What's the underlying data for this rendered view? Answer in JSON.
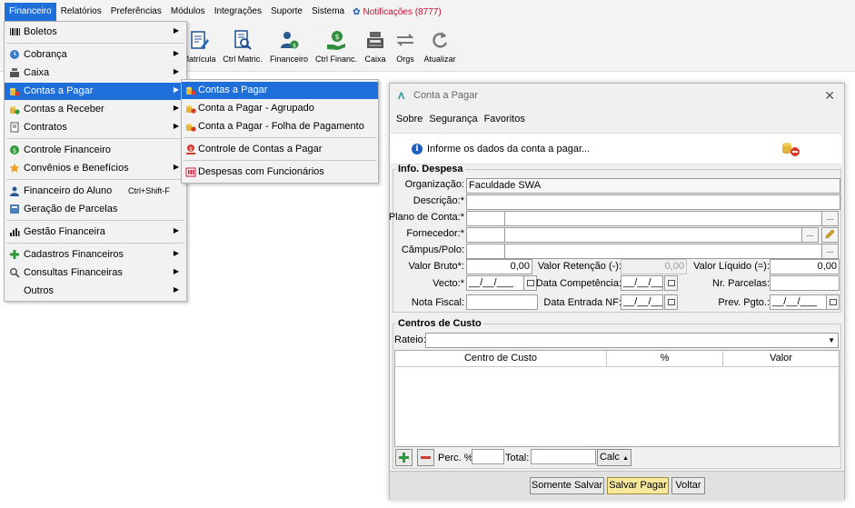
{
  "menubar": {
    "items": [
      "Financeiro",
      "Relatórios",
      "Preferências",
      "Módulos",
      "Integrações",
      "Suporte",
      "Sistema"
    ],
    "notifications": "Notificações (8777)"
  },
  "toolbar": {
    "buttons": [
      {
        "label": "Matrícula",
        "icon": "document-pen-icon"
      },
      {
        "label": "Ctrl Matric.",
        "icon": "document-search-icon"
      },
      {
        "label": "Financeiro",
        "icon": "user-money-icon"
      },
      {
        "label": "Ctrl Financ.",
        "icon": "hand-money-icon"
      },
      {
        "label": "Caixa",
        "icon": "cash-register-icon"
      },
      {
        "label": "Orgs",
        "icon": "arrows-exchange-icon"
      },
      {
        "label": "Atualizar",
        "icon": "refresh-icon"
      }
    ]
  },
  "financeiro_menu": {
    "items": [
      {
        "label": "Boletos",
        "submenu": true
      },
      {
        "label": "Cobrança",
        "submenu": true
      },
      {
        "label": "Caixa",
        "submenu": true
      },
      {
        "label": "Contas a Pagar",
        "submenu": true,
        "selected": true
      },
      {
        "label": "Contas a Receber",
        "submenu": true
      },
      {
        "label": "Contratos",
        "submenu": true
      },
      {
        "label": "Controle Financeiro",
        "submenu": false
      },
      {
        "label": "Convênios e Benefícios",
        "submenu": true
      },
      {
        "label": "Financeiro do Aluno",
        "submenu": false,
        "shortcut": "Ctrl+Shift-F"
      },
      {
        "label": "Geração de Parcelas",
        "submenu": false
      },
      {
        "label": "Gestão Financeira",
        "submenu": true
      },
      {
        "label": "Cadastros Financeiros",
        "submenu": true
      },
      {
        "label": "Consultas Financeiras",
        "submenu": true
      },
      {
        "label": "Outros",
        "submenu": true
      }
    ]
  },
  "contas_pagar_submenu": {
    "items": [
      {
        "label": "Contas a Pagar",
        "selected": true
      },
      {
        "label": "Conta a Pagar - Agrupado"
      },
      {
        "label": "Conta a Pagar - Folha de Pagamento"
      },
      {
        "label": "Controle de Contas a Pagar"
      },
      {
        "label": "Despesas com Funcionários"
      }
    ]
  },
  "dialog": {
    "title": "Conta a Pagar",
    "menu": [
      "Sobre",
      "Segurança",
      "Favoritos"
    ],
    "info": "Informe os dados da conta a pagar...",
    "despesa": {
      "legend": "Info. Despesa",
      "organizacao_label": "Organização:",
      "organizacao_value": "Faculdade SWA",
      "descricao_label": "Descrição:*",
      "plano_label": "Plano de Conta:*",
      "fornecedor_label": "Fornecedor:*",
      "campus_label": "Câmpus/Polo:",
      "valor_bruto_label": "Valor Bruto*:",
      "valor_bruto_value": "0,00",
      "valor_retencao_label": "Valor Retenção (-):",
      "valor_retencao_value": "0,00",
      "valor_liquido_label": "Valor Líquido (=):",
      "valor_liquido_value": "0,00",
      "vecto_label": "Vecto:*",
      "data_competencia_label": "Data Competência:",
      "nr_parcelas_label": "Nr. Parcelas:",
      "nota_fiscal_label": "Nota Fiscal:",
      "data_entrada_label": "Data Entrada NF:",
      "prev_pgto_label": "Prev. Pgto.:",
      "date_placeholder": "__/__/___",
      "ellipsis": "..."
    },
    "centros": {
      "legend": "Centros de Custo",
      "rateio_label": "Rateio:",
      "columns": [
        "Centro de Custo",
        "%",
        "Valor"
      ],
      "perc_label": "Perc. %:",
      "total_label": "Total:",
      "calc_label": "Calc"
    },
    "buttons": {
      "somente_salvar": "Somente Salvar",
      "salvar_pagar": "Salvar Pagar",
      "voltar": "Voltar"
    }
  }
}
